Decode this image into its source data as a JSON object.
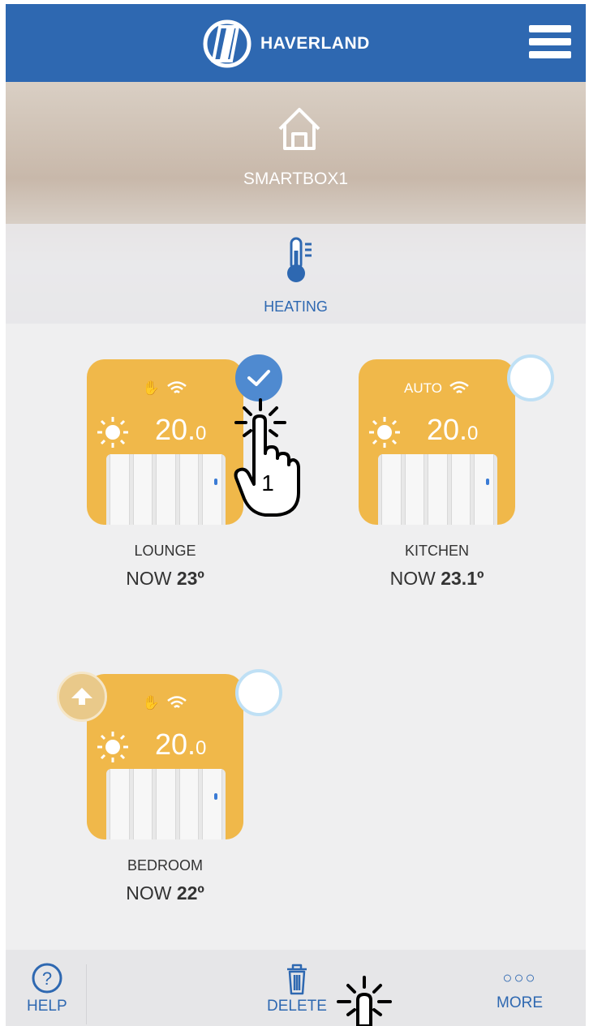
{
  "header": {
    "brand": "HAVERLAND"
  },
  "hero": {
    "title": "SMARTBOX1",
    "subtitle": "HEATING"
  },
  "devices": [
    {
      "name": "LOUNGE",
      "now_prefix": "NOW",
      "now_value": "23º",
      "setpoint_main": "20.",
      "setpoint_decimal": "0",
      "mode": "manual",
      "selected": true
    },
    {
      "name": "KITCHEN",
      "now_prefix": "NOW",
      "now_value": "23.1º",
      "setpoint_main": "20.",
      "setpoint_decimal": "0",
      "mode_label": "AUTO",
      "selected": false
    },
    {
      "name": "BEDROOM",
      "now_prefix": "NOW",
      "now_value": "22º",
      "setpoint_main": "20.",
      "setpoint_decimal": "0",
      "mode": "manual",
      "selected": false
    }
  ],
  "gesture": {
    "tap_number": "1"
  },
  "bottom_bar": {
    "help": "HELP",
    "delete": "DELETE",
    "more": "MORE"
  },
  "colors": {
    "header": "#2e68b1",
    "card": "#f0b84a",
    "accent": "#4f8ad0"
  }
}
